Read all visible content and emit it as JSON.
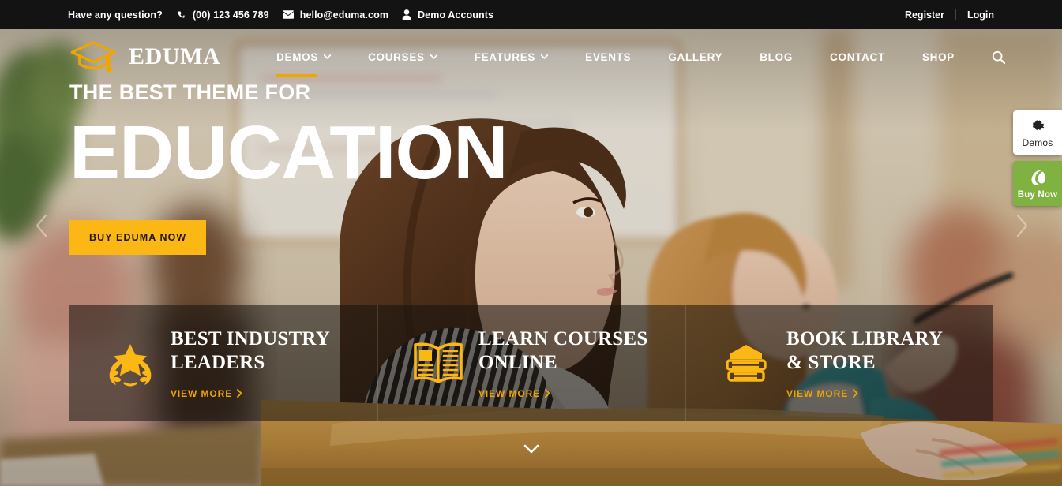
{
  "topbar": {
    "question_label": "Have any question?",
    "phone_icon": "phone-icon",
    "phone": "(00) 123 456 789",
    "mail_icon": "envelope-icon",
    "email": "hello@eduma.com",
    "user_icon": "user-icon",
    "demo_accounts": "Demo Accounts",
    "register": "Register",
    "login": "Login"
  },
  "header": {
    "logo_icon": "graduation-cap-icon",
    "logo_text": "EDUMA",
    "nav": [
      {
        "label": "DEMOS",
        "has_dropdown": true,
        "active": true
      },
      {
        "label": "COURSES",
        "has_dropdown": true,
        "active": false
      },
      {
        "label": "FEATURES",
        "has_dropdown": true,
        "active": false
      },
      {
        "label": "EVENTS",
        "has_dropdown": false,
        "active": false
      },
      {
        "label": "GALLERY",
        "has_dropdown": false,
        "active": false
      },
      {
        "label": "BLOG",
        "has_dropdown": false,
        "active": false
      },
      {
        "label": "CONTACT",
        "has_dropdown": false,
        "active": false
      },
      {
        "label": "SHOP",
        "has_dropdown": false,
        "active": false
      }
    ],
    "search_icon": "search-icon"
  },
  "hero": {
    "kicker": "THE BEST THEME FOR",
    "title": "EDUCATION",
    "cta_label": "BUY EDUMA NOW",
    "prev_icon": "chevron-left-icon",
    "next_icon": "chevron-right-icon",
    "scroll_icon": "chevron-down-icon"
  },
  "cards": [
    {
      "icon": "star-laurel-icon",
      "title_line1": "BEST INDUSTRY",
      "title_line2": "LEADERS",
      "link_label": "VIEW MORE",
      "link_icon": "chevron-right-icon"
    },
    {
      "icon": "open-book-icon",
      "title_line1": "LEARN COURSES",
      "title_line2": "ONLINE",
      "link_label": "VIEW MORE",
      "link_icon": "chevron-right-icon"
    },
    {
      "icon": "book-stack-icon",
      "title_line1": "BOOK LIBRARY",
      "title_line2": "& STORE",
      "link_label": "VIEW MORE",
      "link_icon": "chevron-right-icon"
    }
  ],
  "side_tabs": [
    {
      "icon": "gear-icon",
      "label": "Demos"
    },
    {
      "icon": "envato-leaf-icon",
      "label": "Buy Now"
    }
  ],
  "colors": {
    "accent": "#f0a500",
    "cta": "#fbb713",
    "topbar_bg": "#131313",
    "buy_now_green": "#7fb241",
    "text_light": "#ffffff"
  }
}
